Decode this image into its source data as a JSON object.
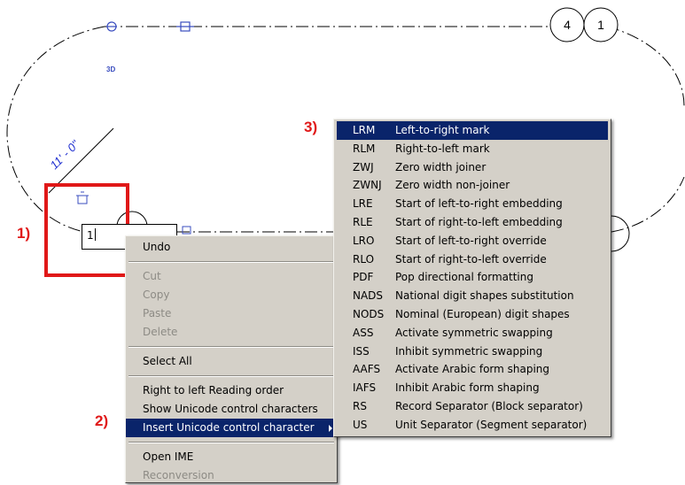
{
  "drawing": {
    "tag_label": "3D",
    "dimension_text": "11' - 0\"",
    "grid_bubbles": [
      "4",
      "1"
    ]
  },
  "annotations": {
    "step1": "1)",
    "step2": "2)",
    "step3": "3)"
  },
  "edit_box": {
    "value": "1"
  },
  "context_menu": {
    "items": [
      {
        "label": "Undo",
        "enabled": true
      },
      {
        "separator": true
      },
      {
        "label": "Cut",
        "enabled": false
      },
      {
        "label": "Copy",
        "enabled": false
      },
      {
        "label": "Paste",
        "enabled": false
      },
      {
        "label": "Delete",
        "enabled": false
      },
      {
        "separator": true
      },
      {
        "label": "Select All",
        "enabled": true
      },
      {
        "separator": true
      },
      {
        "label": "Right to left Reading order",
        "enabled": true
      },
      {
        "label": "Show Unicode control characters",
        "enabled": true
      },
      {
        "label": "Insert Unicode control character",
        "enabled": true,
        "highlighted": true,
        "submenu": true
      },
      {
        "separator": true
      },
      {
        "label": "Open IME",
        "enabled": true
      },
      {
        "label": "Reconversion",
        "enabled": false
      }
    ]
  },
  "unicode_menu": {
    "items": [
      {
        "code": "LRM",
        "desc": "Left-to-right mark",
        "highlighted": true
      },
      {
        "code": "RLM",
        "desc": "Right-to-left mark"
      },
      {
        "code": "ZWJ",
        "desc": "Zero width joiner"
      },
      {
        "code": "ZWNJ",
        "desc": "Zero width non-joiner"
      },
      {
        "code": "LRE",
        "desc": "Start of left-to-right embedding"
      },
      {
        "code": "RLE",
        "desc": "Start of right-to-left embedding"
      },
      {
        "code": "LRO",
        "desc": "Start of left-to-right override"
      },
      {
        "code": "RLO",
        "desc": "Start of right-to-left override"
      },
      {
        "code": "PDF",
        "desc": "Pop directional formatting"
      },
      {
        "code": "NADS",
        "desc": "National digit shapes substitution"
      },
      {
        "code": "NODS",
        "desc": "Nominal (European) digit shapes"
      },
      {
        "code": "ASS",
        "desc": "Activate symmetric swapping"
      },
      {
        "code": "ISS",
        "desc": "Inhibit symmetric swapping"
      },
      {
        "code": "AAFS",
        "desc": "Activate Arabic form shaping"
      },
      {
        "code": "IAFS",
        "desc": "Inhibit Arabic form shaping"
      },
      {
        "code": "RS",
        "desc": "Record Separator (Block separator)"
      },
      {
        "code": "US",
        "desc": "Unit Separator (Segment separator)"
      }
    ]
  },
  "colors": {
    "highlight": "#0a246a",
    "menu_bg": "#d4d0c8",
    "annotation_red": "#e01818",
    "drawing_blue": "#3a4dbf"
  }
}
